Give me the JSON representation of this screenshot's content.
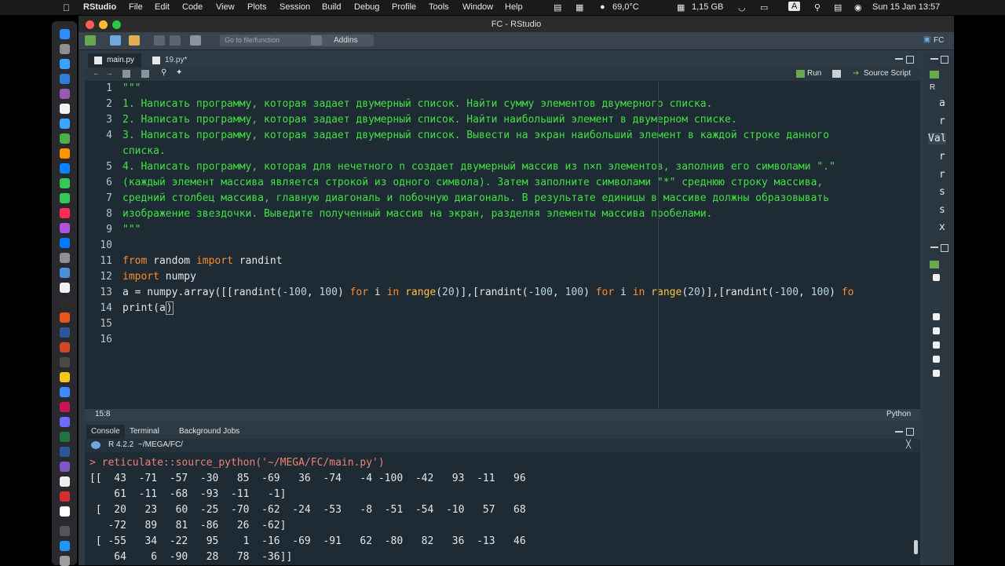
{
  "menubar": {
    "app": "RStudio",
    "items": [
      "File",
      "Edit",
      "Code",
      "View",
      "Plots",
      "Session",
      "Build",
      "Debug",
      "Profile",
      "Tools",
      "Window",
      "Help"
    ],
    "temp": "69,0°C",
    "memory": "1,15 GB",
    "input_lang": "A",
    "datetime": "Sun 15 Jan  13:57"
  },
  "window": {
    "title": "FC - RStudio",
    "project": "FC"
  },
  "toolbar": {
    "goto_placeholder": "Go to file/function",
    "addins": "Addins"
  },
  "editor": {
    "tabs": [
      {
        "label": "main.py"
      },
      {
        "label": "19.py*"
      }
    ],
    "run_label": "Run",
    "source_label": "Source Script",
    "cursor_pos": "15:8",
    "language": "Python",
    "line_numbers": [
      "1",
      "2",
      "3",
      "4",
      "5",
      "6",
      "7",
      "8",
      "9",
      "10",
      "11",
      "12",
      "13",
      "14",
      "15",
      "16"
    ],
    "lines": [
      "\"\"\"",
      "1. Написать программу, которая задает двумерный список. Найти сумму элементов двумерного списка.",
      "2. Написать программу, которая задает двумерный список. Найти наибольший элемент в двумерном списке.",
      "3. Написать программу, которая задает двумерный список. Вывести на экран наибольший элемент в каждой строке данного",
      "списка.",
      "4. Написать программу, которая для нечетного n создает двумерный массив из n×n элементов, заполнив его символами \".\"",
      "(каждый элемент массива является строкой из одного символа). Затем заполните символами \"*\" среднюю строку массива,",
      "средний столбец массива, главную диагональ и побочную диагональ. В результате единицы в массиве должны образовывать",
      "изображение звездочки. Выведите полученный массив на экран, разделяя элементы массива пробелами.",
      "\"\"\""
    ],
    "code": {
      "l12": [
        "from",
        " random ",
        "import",
        " randint"
      ],
      "l13": [
        "import",
        " numpy"
      ],
      "l14": [
        "a = numpy.array([[randint(",
        "-100",
        ", ",
        "100",
        ") ",
        "for",
        " i ",
        "in",
        " ",
        "range",
        "(",
        "20",
        ")],[randint(",
        "-100",
        ", ",
        "100",
        ") ",
        "for",
        " i ",
        "in",
        " ",
        "range",
        "(",
        "20",
        ")],[randint(",
        "-100",
        ", ",
        "100",
        ") ",
        "fo"
      ],
      "l15": [
        "print(a",
        ")"
      ]
    }
  },
  "console": {
    "tabs": [
      "Console",
      "Terminal",
      "Background Jobs"
    ],
    "r_version": "R 4.2.2",
    "path": "~/MEGA/FC/",
    "command": "> reticulate::source_python('~/MEGA/FC/main.py')",
    "output": [
      "[[  43  -71  -57  -30   85  -69   36  -74   -4 -100  -42   93  -11   96",
      "    61  -11  -68  -93  -11   -1]",
      " [  20   23   60  -25  -70  -62  -24  -53   -8  -51  -54  -10   57   68",
      "   -72   89   81  -86   26  -62]",
      " [ -55   34  -22   95    1  -16  -69  -91   62  -80   82   36  -13   46",
      "    64    6  -90   28   78  -36]]"
    ]
  },
  "right_panel": {
    "env_tab": "R",
    "chars": [
      "a",
      "r",
      "Val",
      "r",
      "r",
      "s",
      "s",
      "x"
    ]
  },
  "colors": {
    "editor_bg": "#1e2b35",
    "comment_green": "#43e043",
    "keyword_orange": "#ff8c2a",
    "function_yellow": "#ffc040"
  }
}
